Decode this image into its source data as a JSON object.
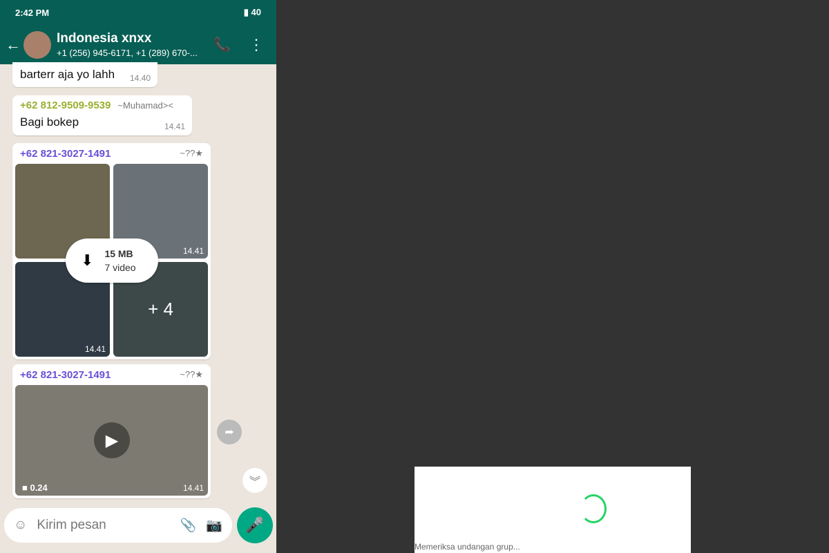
{
  "status": {
    "time": "2:42 PM",
    "battery": "40"
  },
  "header": {
    "title": "Indonesia xnxx",
    "subtitle": "+1 (256) 945-6171, +1 (289) 670-..."
  },
  "messages": [
    {
      "text": "barterr aja yo lahh",
      "time": "14.40"
    },
    {
      "sender": "+62 812-9509-9539",
      "alias": "~Muhamad><",
      "text": "Bagi bokep",
      "time": "14.41"
    },
    {
      "sender": "+62 821-3027-1491",
      "alias": "~??★",
      "album": {
        "size": "15 MB",
        "count": "7 video",
        "more": "+ 4",
        "times": [
          "14.41",
          "14.41"
        ]
      }
    },
    {
      "sender": "+62 821-3027-1491",
      "alias": "~??★",
      "video": {
        "duration": "0.24",
        "time": "14.41"
      }
    }
  ],
  "input": {
    "placeholder": "Kirim pesan"
  },
  "dialog": {
    "text": "Memeriksa undangan grup..."
  },
  "colors": {
    "header": "#075e54",
    "accent": "#25d366"
  }
}
